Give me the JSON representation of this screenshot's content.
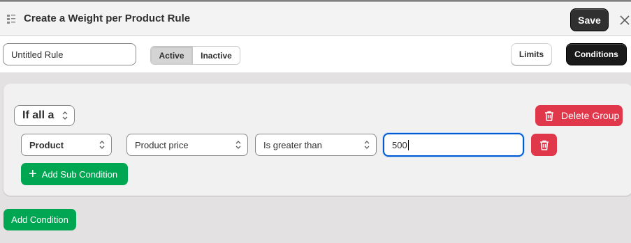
{
  "header": {
    "app_icon": "rule-list-icon",
    "title": "Create a Weight per Product Rule",
    "save_label": "Save",
    "close_icon": "close-icon"
  },
  "toolbar": {
    "rule_name": "Untitled Rule",
    "status_options": [
      "Active",
      "Inactive"
    ],
    "status_selected": "Active",
    "limits_label": "Limits",
    "conditions_label": "Conditions"
  },
  "group": {
    "match_selected": "If all a",
    "delete_group_label": "Delete Group",
    "condition": {
      "type": "Product",
      "field": "Product price",
      "operator": "Is greater than",
      "value": "500"
    },
    "add_sub_condition_label": "Add Sub Condition"
  },
  "add_condition_label": "Add Condition",
  "colors": {
    "primary_dark": "#303030",
    "danger": "#e0374a",
    "success": "#00a651",
    "focus": "#005bd3"
  }
}
